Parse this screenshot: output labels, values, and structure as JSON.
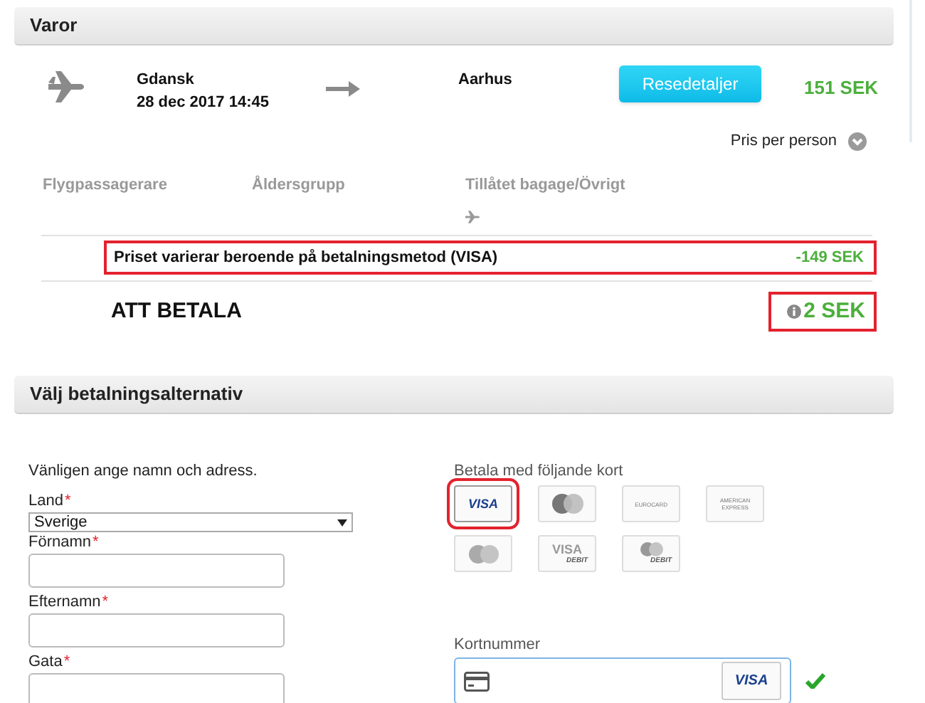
{
  "items_section": {
    "title": "Varor"
  },
  "flight": {
    "from": "Gdansk",
    "date": "28 dec 2017 14:45",
    "to": "Aarhus",
    "details_button": "Resedetaljer",
    "price": "151 SEK",
    "price_note": "Pris per person"
  },
  "passenger_columns": [
    "Flygpassagerare",
    "Åldersgrupp",
    "Tillåtet bagage/Övrigt"
  ],
  "price_adjustment": {
    "text": "Priset varierar beroende på betalningsmetod (VISA)",
    "amount": "-149 SEK",
    "highlighted": true
  },
  "total": {
    "label": "ATT BETALA",
    "amount": "2 SEK",
    "highlighted": true
  },
  "payment_section": {
    "title": "Välj betalningsalternativ"
  },
  "address_form": {
    "intro": "Vänligen ange namn och adress.",
    "fields": [
      {
        "kind": "select",
        "label": "Land",
        "required_mark": "*",
        "value": "Sverige"
      },
      {
        "kind": "text",
        "label": "Förnamn",
        "required_mark": "*"
      },
      {
        "kind": "text",
        "label": "Efternamn",
        "required_mark": "*"
      },
      {
        "kind": "text",
        "label": "Gata",
        "required_mark": "*"
      }
    ]
  },
  "cards": {
    "label": "Betala med följande kort",
    "options": [
      {
        "kind": "visa",
        "lines": [
          "VISA"
        ],
        "selected": true
      },
      {
        "kind": "mastercard",
        "selected": false
      },
      {
        "kind": "wordmark",
        "lines": [
          "EUROCARD"
        ],
        "selected": false
      },
      {
        "kind": "wordmark",
        "lines": [
          "AMERICAN",
          "EXPRESS"
        ],
        "selected": false
      },
      {
        "kind": "maestro",
        "selected": false
      },
      {
        "kind": "visa_debit",
        "lines": [
          "VISA",
          "DEBIT"
        ],
        "selected": false
      },
      {
        "kind": "mastercard_debit",
        "lines": [
          "DEBIT"
        ],
        "selected": false
      }
    ]
  },
  "card_number": {
    "label": "Kortnummer",
    "brand": "VISA",
    "valid": true
  }
}
